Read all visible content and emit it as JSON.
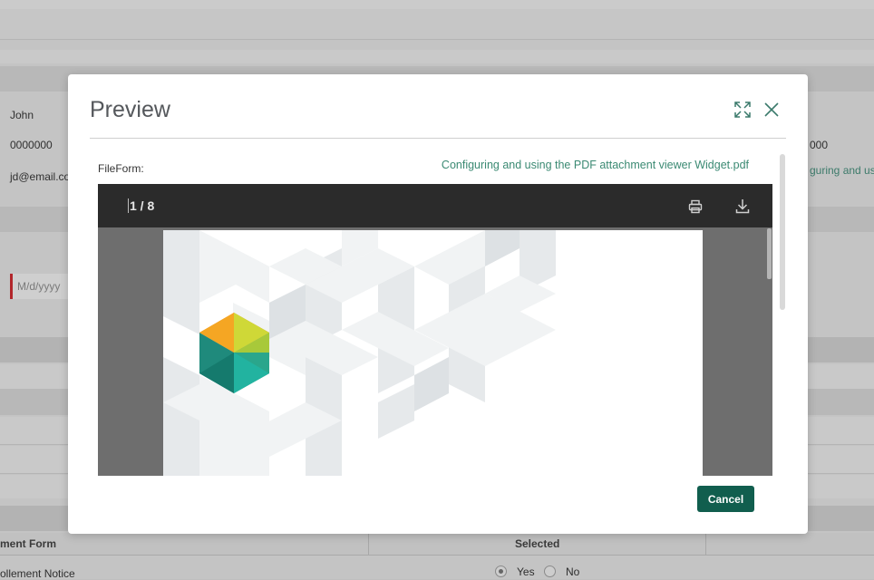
{
  "background": {
    "fields": {
      "first_name": "John",
      "phone": "0000000",
      "email": "jd@email.co",
      "date_placeholder": "M/d/yyyy",
      "right_number": "000",
      "right_link": "guring and us"
    },
    "table": {
      "headers": [
        "ment Form",
        "Selected"
      ],
      "row_label": "ollement Notice",
      "radio_yes": "Yes",
      "radio_no": "No"
    }
  },
  "modal": {
    "title": "Preview",
    "file_label": "FileForm:",
    "file_name": "Configuring and using the PDF attachment viewer Widget.pdf",
    "viewer": {
      "page_indicator": "1 / 8"
    },
    "cancel_label": "Cancel"
  },
  "icons": {
    "expand": "expand-icon",
    "close": "close-icon",
    "print": "print-icon",
    "download": "download-icon"
  },
  "colors": {
    "accent": "#115e4e",
    "link": "#3b8a73",
    "required": "#b2262b",
    "toolbar": "#2b2b2b"
  }
}
